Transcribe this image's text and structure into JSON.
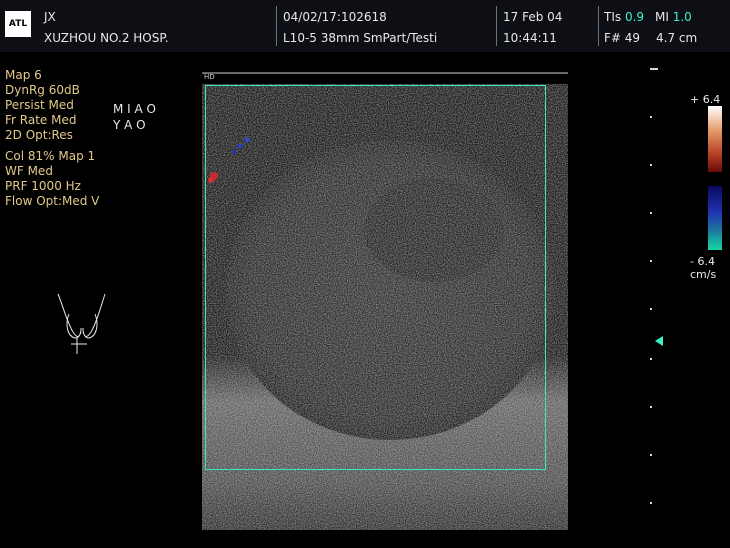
{
  "header": {
    "logo_text": "ATL",
    "user": "JX",
    "hospital": "XUZHOU NO.2 HOSP.",
    "exam_id": "04/02/17:102618",
    "probe": "L10-5 38mm SmPart/Testi",
    "date": "17 Feb 04",
    "time": "10:44:11",
    "tis_label": "TIs",
    "tis_value": "0.9",
    "mi_label": "MI",
    "mi_value": "1.0",
    "frame": "F# 49",
    "depth": "4.7 cm"
  },
  "settings": {
    "map": "Map 6",
    "dyn_range": "DynRg 60dB",
    "persist": "Persist Med",
    "fr_rate": "Fr Rate Med",
    "opt_2d": "2D Opt:Res",
    "col": "Col 81%  Map 1",
    "wf": "WF Med",
    "prf": "PRF 1000  Hz",
    "flow_opt": "Flow Opt:Med V"
  },
  "patient_name": {
    "line1": "M I A O",
    "line2": "Y A O"
  },
  "velocity_scale": {
    "top": "+ 6.4",
    "bottom": "- 6.4",
    "unit": "cm/s"
  },
  "colors": {
    "accent_cyan": "#3cf2c8",
    "settings_text": "#e3c98a"
  }
}
